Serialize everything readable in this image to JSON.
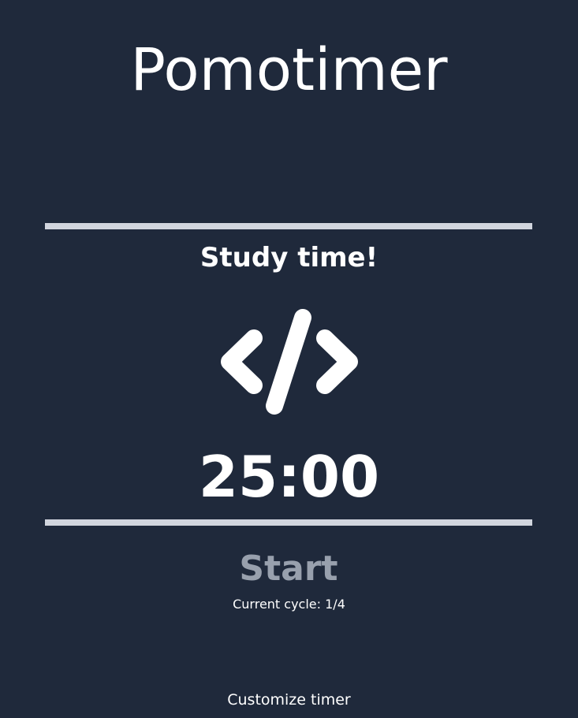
{
  "app": {
    "title": "Pomotimer"
  },
  "timer": {
    "mode_label": "Study time!",
    "mode_icon": "code-icon",
    "display": "25:00",
    "start_label": "Start",
    "cycle_text": "Current cycle: 1/4"
  },
  "footer": {
    "customize_label": "Customize timer"
  },
  "colors": {
    "background": "#1f293b",
    "divider": "#d1d5de",
    "text": "#ffffff",
    "start_button": "#98a0ad"
  }
}
